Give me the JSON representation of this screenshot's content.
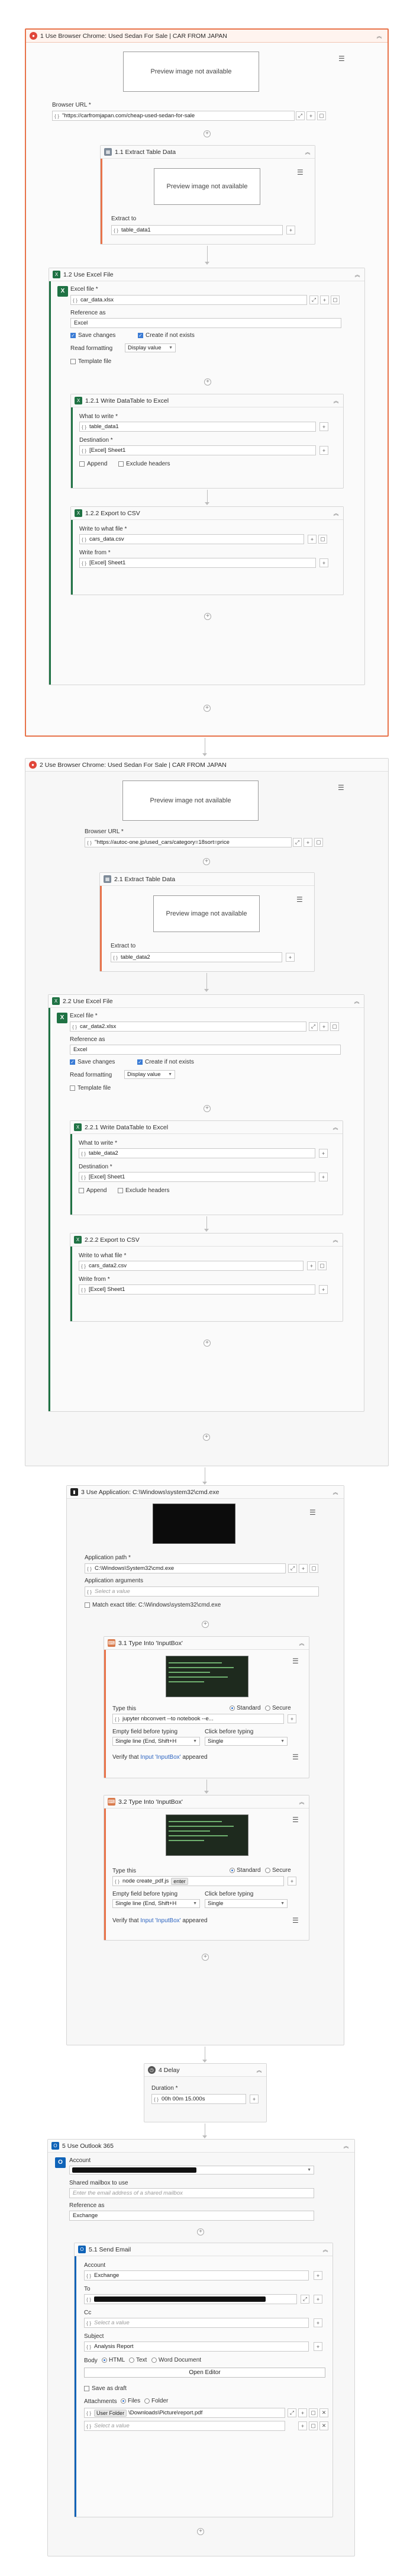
{
  "common": {
    "preview_text": "Preview image not available",
    "browser_url_label": "Browser URL *",
    "extract_to_label": "Extract to",
    "excel_file_label": "Excel file *",
    "reference_as_label": "Reference as",
    "save_changes": "Save changes",
    "create_if_not_exists": "Create if not exists",
    "read_formatting_label": "Read formatting",
    "read_formatting_value": "Display value",
    "template_file": "Template file",
    "what_to_write_label": "What to write *",
    "destination_label": "Destination *",
    "append": "Append",
    "exclude_headers": "Exclude headers",
    "write_to_file_label": "Write to what file *",
    "write_from_label": "Write from *",
    "fx": "{ }",
    "expand_icon_text": "⤢",
    "add_icon_text": "+",
    "folder_icon_text": "▢",
    "more_icon_text": "⋯"
  },
  "block1": {
    "title": "1 Use Browser Chrome: Used Sedan For Sale | CAR FROM JAPAN",
    "url": "\"https://carfromjapan.com/cheap-used-sedan-for-sale",
    "extract": {
      "title": "1.1 Extract Table Data",
      "extract_to": "table_data1"
    },
    "excel": {
      "title": "1.2 Use Excel File",
      "file": "car_data.xlsx",
      "reference_as": "Excel",
      "write": {
        "title": "1.2.1 Write DataTable to Excel",
        "what": "table_data1",
        "dest": "[Excel] Sheet1"
      },
      "csv": {
        "title": "1.2.2 Export to CSV",
        "file": "cars_data.csv",
        "from": "[Excel] Sheet1"
      }
    }
  },
  "block2": {
    "title": "2 Use Browser Chrome: Used Sedan For Sale | CAR FROM JAPAN",
    "url": "\"https://autoc-one.jp/used_cars/category=18sort=price",
    "extract": {
      "title": "2.1 Extract Table Data",
      "extract_to": "table_data2"
    },
    "excel": {
      "title": "2.2 Use Excel File",
      "file": "car_data2.xlsx",
      "reference_as": "Excel",
      "write": {
        "title": "2.2.1 Write DataTable to Excel",
        "what": "table_data2",
        "dest": "[Excel] Sheet1"
      },
      "csv": {
        "title": "2.2.2 Export to CSV",
        "file": "cars_data2.csv",
        "from": "[Excel] Sheet1"
      }
    }
  },
  "block3": {
    "title": "3 Use Application: C:\\Windows\\system32\\cmd.exe",
    "app_path_label": "Application path *",
    "app_path": "C:\\Windows\\System32\\cmd.exe",
    "app_args_label": "Application arguments",
    "app_args_ph": "Select a value",
    "match_title": "Match exact title: C:\\Windows\\system32\\cmd.exe",
    "type_this_label": "Type this",
    "standard": "Standard",
    "secure": "Secure",
    "empty_field_label": "Empty field before typing",
    "click_before_label": "Click before typing",
    "empty_value": "Single line (End, Shift+H",
    "click_value": "Single",
    "type1": {
      "title": "3.1 Type Into 'InputBox'",
      "text": "jupyter nbconvert --to notebook --e...",
      "verify_pre": "Verify that",
      "verify_target": "Input 'InputBox'",
      "verify_post": "appeared"
    },
    "type2": {
      "title": "3.2 Type Into 'InputBox'",
      "text": "node create_pdf.js",
      "enter_chip": "enter",
      "verify_pre": "Verify that",
      "verify_target": "Input 'InputBox'",
      "verify_post": "appeared"
    }
  },
  "block4": {
    "title": "4 Delay",
    "duration_label": "Duration *",
    "duration": "00h 00m 15.000s"
  },
  "block5": {
    "title": "5 Use Outlook 365",
    "account_label": "Account",
    "shared_mailbox_label": "Shared mailbox to use",
    "shared_mailbox_ph": "Enter the email address of a shared mailbox",
    "reference_as_label": "Reference as",
    "reference_as": "Exchange",
    "send": {
      "title": "5.1 Send Email",
      "account_label": "Account",
      "account": "Exchange",
      "to_label": "To",
      "cc_label": "Cc",
      "cc_ph": "Select a value",
      "subject_label": "Subject",
      "subject": "Analysis Report",
      "body_label": "Body",
      "body_html": "HTML",
      "body_text": "Text",
      "body_word": "Word Document",
      "open_editor": "Open Editor",
      "save_draft": "Save as draft",
      "attachments_label": "Attachments",
      "files": "Files",
      "folder": "Folder",
      "attach_chip": "User Folder",
      "attach_path": "\\Downloads\\Picture\\report.pdf",
      "attach_ph": "Select a value"
    }
  }
}
